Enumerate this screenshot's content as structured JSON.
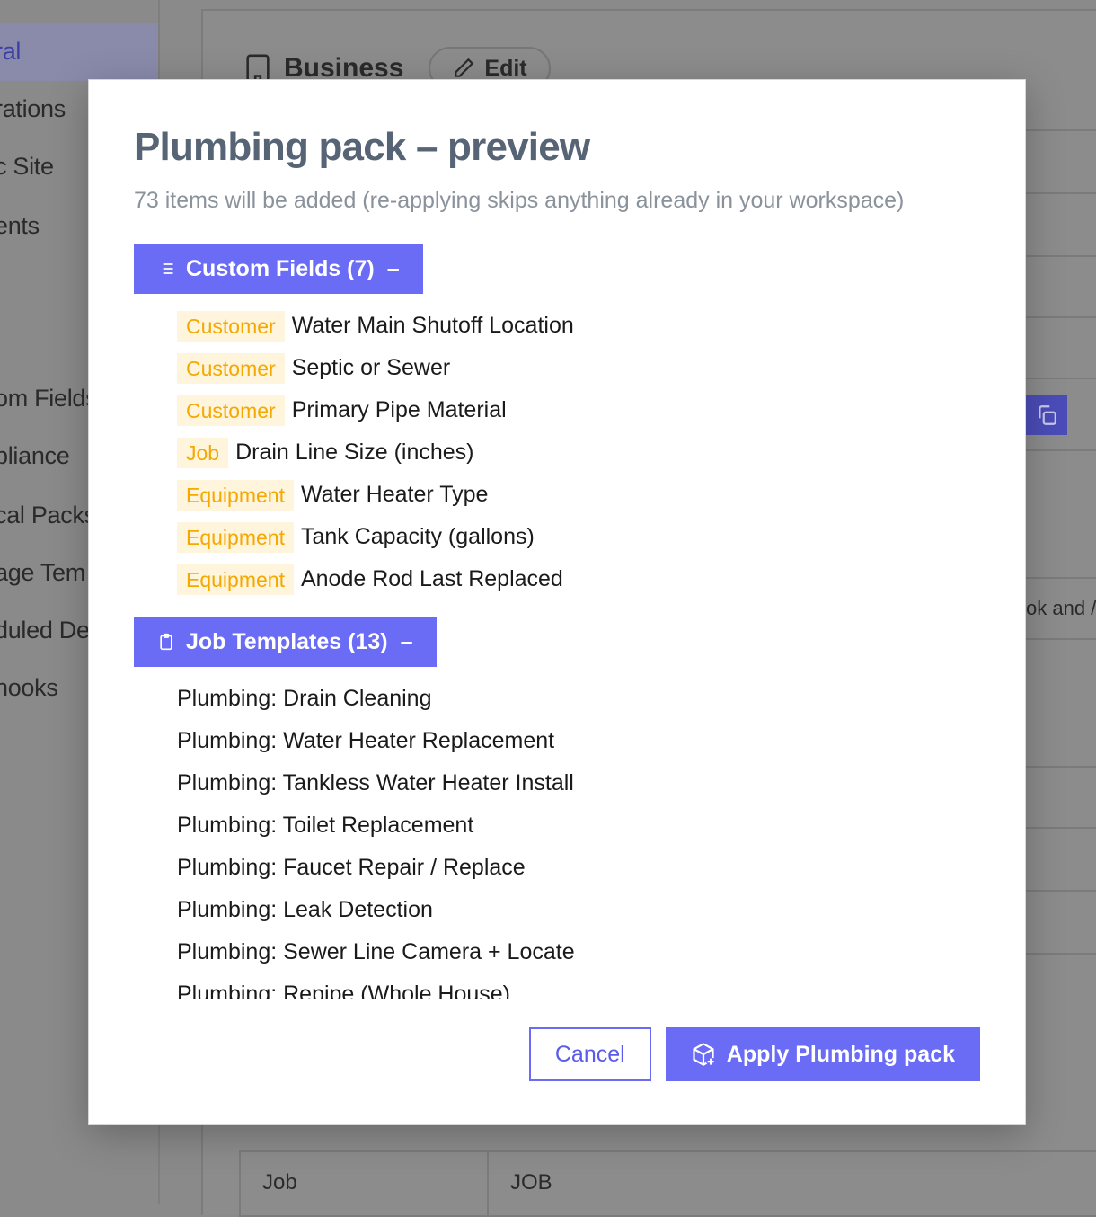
{
  "background": {
    "sidebar": {
      "items": [
        {
          "label": "ral",
          "active": true
        },
        {
          "label": "rations"
        },
        {
          "label": "c Site"
        },
        {
          "label": "ents"
        },
        {
          "label": "om Fields"
        },
        {
          "label": "pliance"
        },
        {
          "label": "cal Packs"
        },
        {
          "label": "age Tem"
        },
        {
          "label": "duled De"
        },
        {
          "label": "hooks"
        }
      ]
    },
    "header": {
      "title": "Business",
      "edit_label": "Edit"
    },
    "side_text": "ok and /",
    "table": {
      "col1": "Job",
      "col2": "JOB"
    }
  },
  "modal": {
    "title": "Plumbing pack – preview",
    "subtitle": "73 items will be added (re-applying skips anything already in your workspace)",
    "sections": {
      "custom_fields": {
        "label": "Custom Fields (7)",
        "toggle": "–",
        "items": [
          {
            "tag": "Customer",
            "name": "Water Main Shutoff Location"
          },
          {
            "tag": "Customer",
            "name": "Septic or Sewer"
          },
          {
            "tag": "Customer",
            "name": "Primary Pipe Material"
          },
          {
            "tag": "Job",
            "name": "Drain Line Size (inches)"
          },
          {
            "tag": "Equipment",
            "name": "Water Heater Type"
          },
          {
            "tag": "Equipment",
            "name": "Tank Capacity (gallons)"
          },
          {
            "tag": "Equipment",
            "name": "Anode Rod Last Replaced"
          }
        ]
      },
      "job_templates": {
        "label": "Job Templates (13)",
        "toggle": "–",
        "items": [
          "Plumbing: Drain Cleaning",
          "Plumbing: Water Heater Replacement",
          "Plumbing: Tankless Water Heater Install",
          "Plumbing: Toilet Replacement",
          "Plumbing: Faucet Repair / Replace",
          "Plumbing: Leak Detection",
          "Plumbing: Sewer Line Camera + Locate",
          "Plumbing: Repipe (Whole House)"
        ]
      }
    },
    "footer": {
      "cancel_label": "Cancel",
      "apply_label": "Apply Plumbing pack"
    }
  },
  "colors": {
    "accent": "#6b6cf6",
    "tag_bg": "#fff4dc",
    "tag_text": "#f5a800",
    "title": "#566476",
    "overlay": "#8a8a8a"
  },
  "icons": {
    "custom_fields": "list-icon",
    "job_templates": "clipboard-icon",
    "apply": "package-plus-icon",
    "business": "building-icon",
    "edit": "pencil-icon",
    "copy": "copy-icon"
  }
}
